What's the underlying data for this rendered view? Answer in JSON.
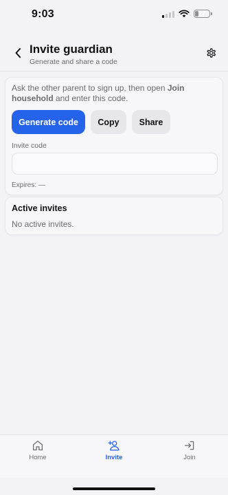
{
  "status_bar": {
    "time": "9:03",
    "battery": "27",
    "battery_level": 0.27
  },
  "header": {
    "title": "Invite guardian",
    "subtitle": "Generate and share a code"
  },
  "invite_card": {
    "instructions_prefix": "Ask the other parent to sign up, then open ",
    "instructions_bold": "Join household",
    "instructions_suffix": " and enter this code.",
    "generate_label": "Generate code",
    "copy_label": "Copy",
    "share_label": "Share",
    "code_label": "Invite code",
    "code_value": "",
    "expires_text": "Expires: —"
  },
  "active_invites": {
    "title": "Active invites",
    "empty_text": "No active invites."
  },
  "tabs": [
    {
      "label": "Home",
      "icon": "home-icon",
      "active": false
    },
    {
      "label": "Invite",
      "icon": "person-add-icon",
      "active": true
    },
    {
      "label": "Join",
      "icon": "sign-in-icon",
      "active": false
    }
  ],
  "colors": {
    "accent": "#2563eb",
    "background": "#f2f2f7",
    "card": "#f7f7fa",
    "muted_text": "#6b6b70"
  }
}
